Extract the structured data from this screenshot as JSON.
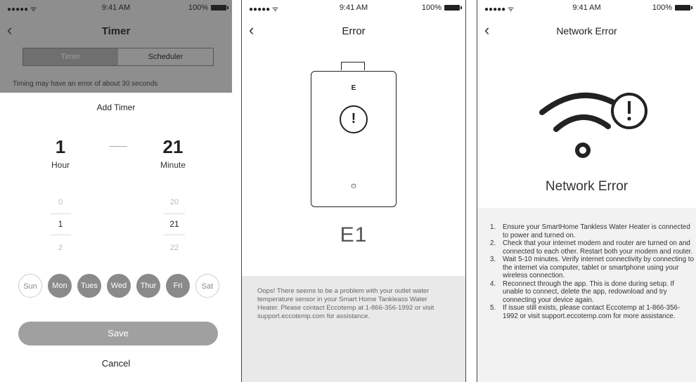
{
  "timer_screen": {
    "status": {
      "signal": "●●●●● ᯤ",
      "time": "9:41 AM",
      "battery": "100%"
    },
    "nav": {
      "back": "‹",
      "title": "Timer"
    },
    "segments": [
      "Timer",
      "Scheduler"
    ],
    "note": "Timing may have an error of about 30 seconds",
    "sheet_title": "Add Timer",
    "hour": {
      "value": "1",
      "label": "Hour",
      "picker": [
        "0",
        "1",
        "2"
      ]
    },
    "minute": {
      "value": "21",
      "label": "Minute",
      "picker": [
        "20",
        "21",
        "22"
      ]
    },
    "days": [
      {
        "label": "Sun",
        "selected": false
      },
      {
        "label": "Mon",
        "selected": true
      },
      {
        "label": "Tues",
        "selected": true
      },
      {
        "label": "Wed",
        "selected": true
      },
      {
        "label": "Thur",
        "selected": true
      },
      {
        "label": "Fri",
        "selected": true
      },
      {
        "label": "Sat",
        "selected": false
      }
    ],
    "save": "Save",
    "cancel": "Cancel"
  },
  "error_screen": {
    "status": {
      "signal": "●●●●● ᯤ",
      "time": "9:41 AM",
      "battery": "100%"
    },
    "nav": {
      "back": "‹",
      "title": "Error"
    },
    "device_logo": "E",
    "device_power": "⏻",
    "code": "E1",
    "message": "Oops! There seems to be a problem with your outlet water temperature sensor in your Smart Home Tankleass Water Heater. Please contact Eccotemp at 1-866-356-1992 or visit support.eccotemp.com for assistance."
  },
  "network_screen": {
    "status": {
      "signal": "●●●●● ᯤ",
      "time": "9:41 AM",
      "battery": "100%"
    },
    "nav": {
      "back": "‹",
      "title": "Network Error"
    },
    "heading": "Network Error",
    "steps": [
      "Ensure your SmartHome Tankless Water Heater is connected to power and turned on.",
      "Check that your internet modem and router are turned on and connected to each other. Restart both your modem and router.",
      "Wait 5-10 minutes. Verify internet connectivity by connecting to the internet via computer, tablet or smartphone using your wireless connection.",
      "Reconnect through the app. This is done during setup. If unable to connect, delete the app, redownload and try connecting your device again.",
      "If issue still exists, please contact Eccotemp at 1-866-356-1992 or visit support.eccotemp.com for more assistance."
    ]
  }
}
